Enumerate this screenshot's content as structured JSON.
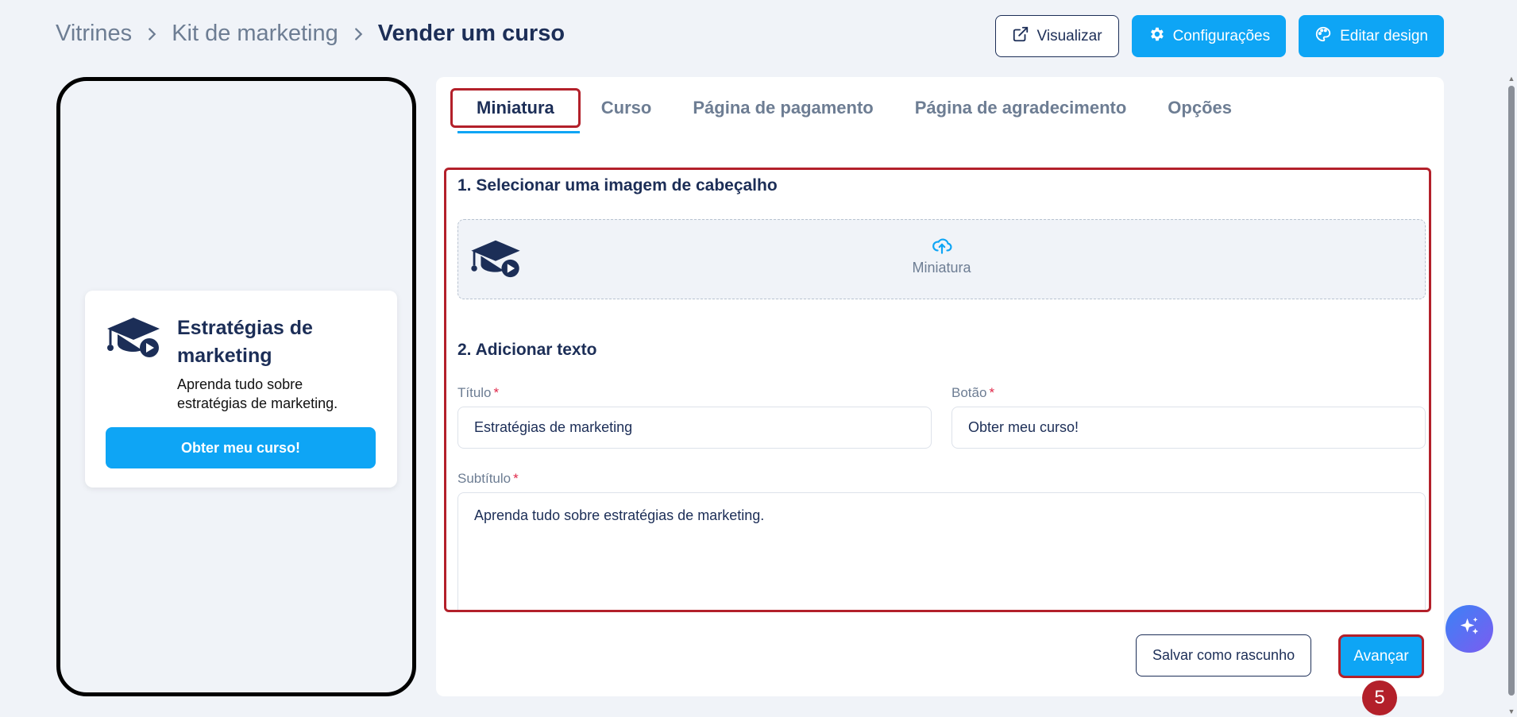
{
  "breadcrumb": {
    "items": [
      "Vitrines",
      "Kit de marketing"
    ],
    "current": "Vender um curso"
  },
  "toolbar": {
    "preview_label": "Visualizar",
    "settings_label": "Configurações",
    "edit_design_label": "Editar design"
  },
  "preview_card": {
    "title": "Estratégias de marketing",
    "subtitle": "Aprenda tudo sobre estratégias de marketing.",
    "button": "Obter meu curso!"
  },
  "tabs": [
    {
      "label": "Miniatura",
      "active": true
    },
    {
      "label": "Curso",
      "active": false
    },
    {
      "label": "Página de pagamento",
      "active": false
    },
    {
      "label": "Página de agradecimento",
      "active": false
    },
    {
      "label": "Opções",
      "active": false
    }
  ],
  "section1": {
    "title": "1. Selecionar uma imagem de cabeçalho",
    "upload_label": "Miniatura"
  },
  "section2": {
    "title": "2. Adicionar texto",
    "title_field": {
      "label": "Título",
      "required_mark": "*",
      "value": "Estratégias de marketing"
    },
    "button_field": {
      "label": "Botão",
      "required_mark": "*",
      "value": "Obter meu curso!"
    },
    "subtitle_field": {
      "label": "Subtítulo",
      "required_mark": "*",
      "value": "Aprenda tudo sobre estratégias de marketing."
    }
  },
  "actions": {
    "save_draft": "Salvar como rascunho",
    "next": "Avançar"
  },
  "step_badge": "5",
  "colors": {
    "primary": "#0ea5f5",
    "navy": "#1c2e57",
    "highlight": "#b3202a"
  }
}
